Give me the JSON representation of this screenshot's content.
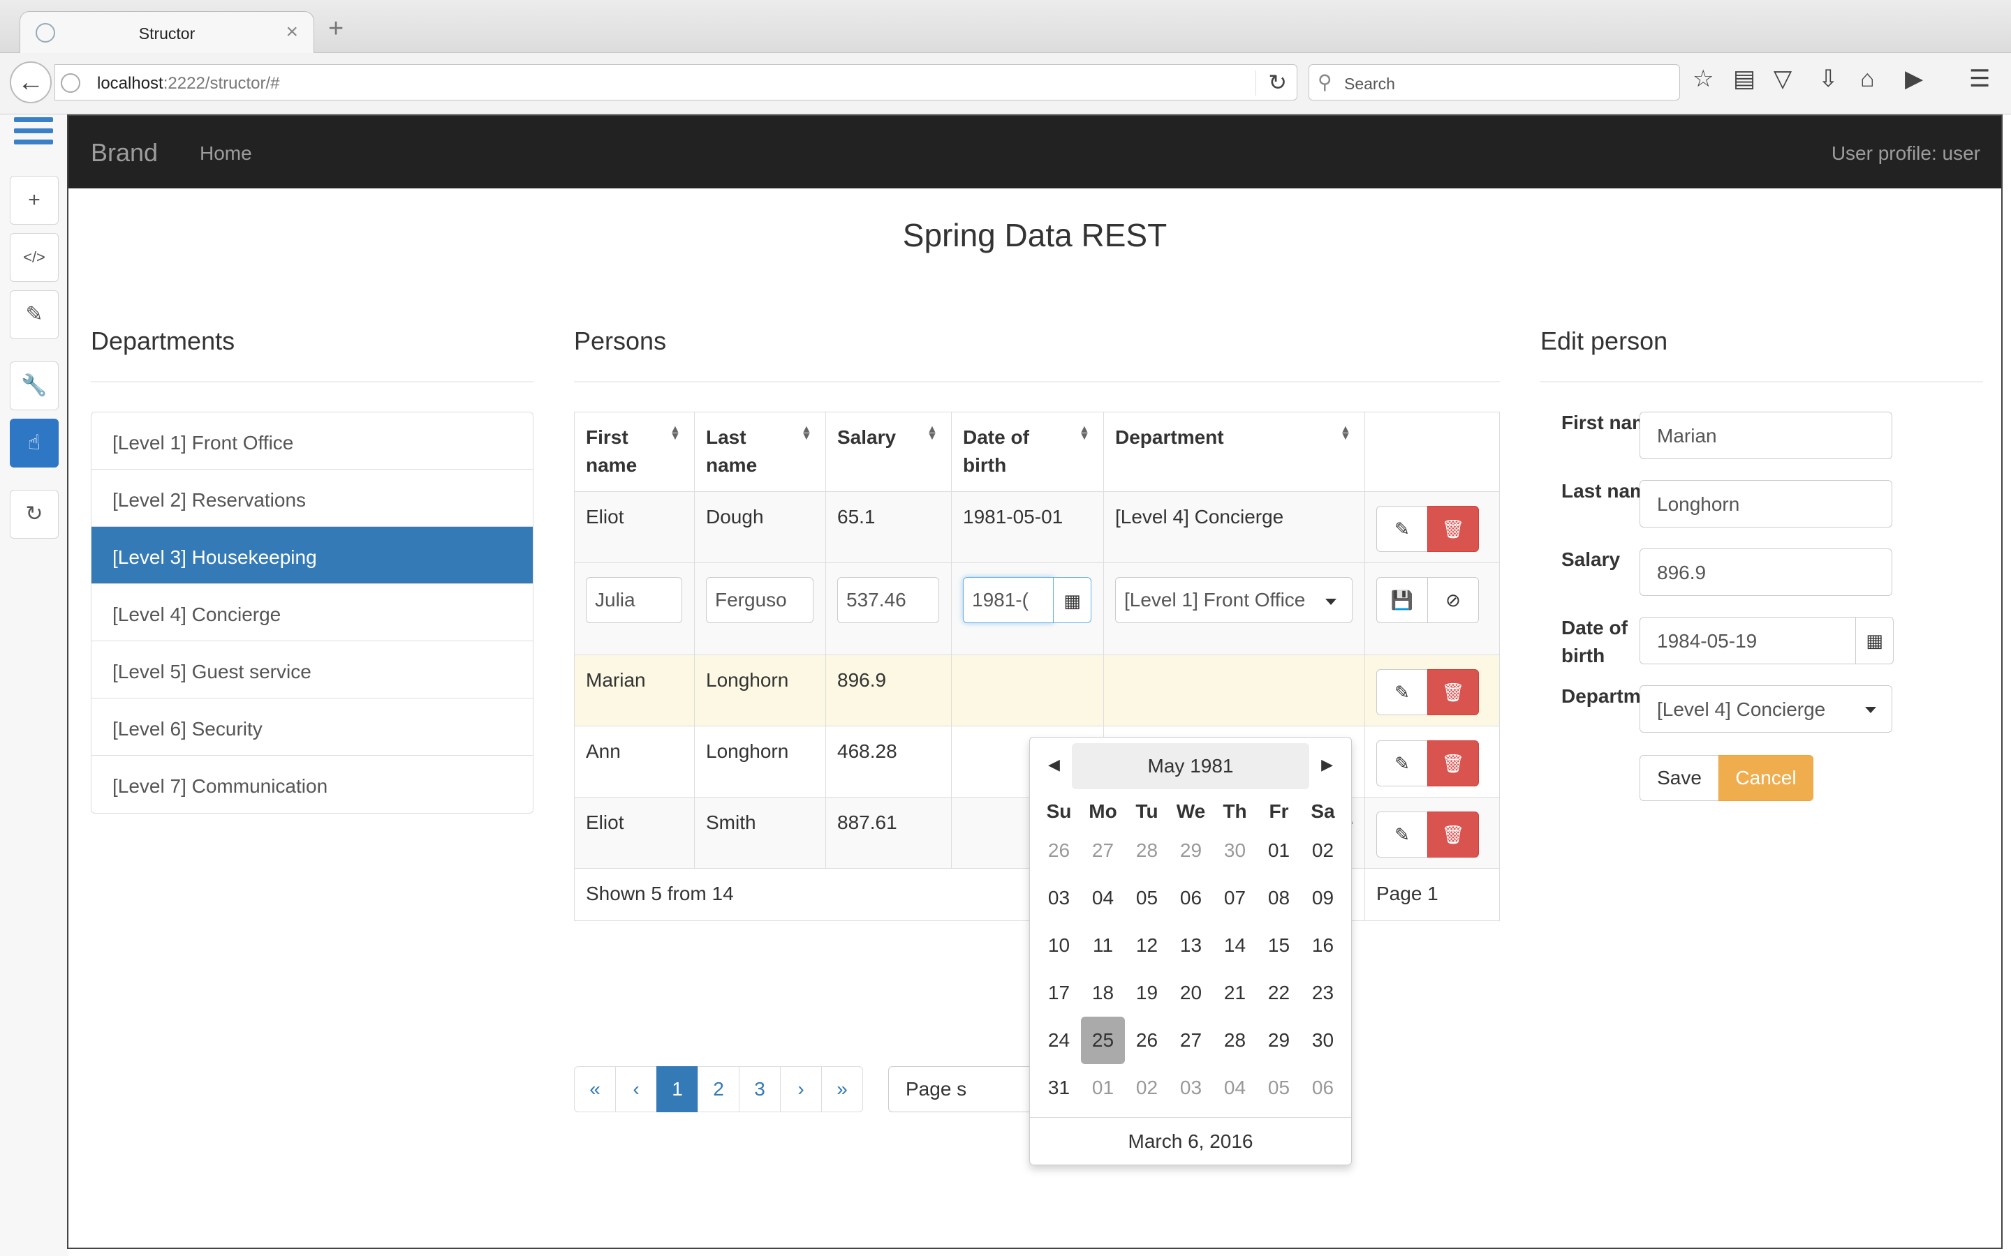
{
  "browser": {
    "tab_title": "Structor",
    "tab_close": "×",
    "new_tab": "+",
    "url_host": "localhost",
    "url_rest": ":2222/structor/#",
    "search_placeholder": "Search"
  },
  "app": {
    "brand": "Brand",
    "nav_home": "Home",
    "user_profile": "User profile: user",
    "page_title": "Spring Data REST"
  },
  "departments": {
    "heading": "Departments",
    "items": [
      {
        "label": "[Level 1] Front Office"
      },
      {
        "label": "[Level 2] Reservations"
      },
      {
        "label": "[Level 3] Housekeeping"
      },
      {
        "label": "[Level 4] Concierge"
      },
      {
        "label": "[Level 5] Guest service"
      },
      {
        "label": "[Level 6] Security"
      },
      {
        "label": "[Level 7] Communication"
      }
    ],
    "selected_index": 2
  },
  "persons": {
    "heading": "Persons",
    "columns": {
      "first_name": "First\nname",
      "last_name": "Last\nname",
      "salary": "Salary",
      "dob": "Date of\nbirth",
      "department": "Department"
    },
    "rows": [
      {
        "first": "Eliot",
        "last": "Dough",
        "salary": "65.1",
        "dob": "1981-05-01",
        "dept": "[Level 4] Concierge"
      },
      {
        "first": "Marian",
        "last": "Longhorn",
        "salary": "896.9",
        "dob": "",
        "dept": ""
      },
      {
        "first": "Ann",
        "last": "Longhorn",
        "salary": "468.28",
        "dob": "",
        "dept": ""
      },
      {
        "first": "Eliot",
        "last": "Smith",
        "salary": "887.61",
        "dob": "",
        "dept": "ice"
      }
    ],
    "editing_row": {
      "first": "Julia",
      "last": "Ferguso",
      "salary": "537.46",
      "dob": "1981-(",
      "dept": "[Level 1] Front Office"
    },
    "footer_shown": "Shown 5 from 14",
    "footer_page": "Page 1",
    "pagination": [
      "«",
      "‹",
      "1",
      "2",
      "3",
      "›",
      "»"
    ],
    "active_page": "1",
    "page_size_label": "Page s"
  },
  "datepicker": {
    "month_label": "May 1981",
    "weekdays": [
      "Su",
      "Mo",
      "Tu",
      "We",
      "Th",
      "Fr",
      "Sa"
    ],
    "weeks": [
      [
        "26",
        "27",
        "28",
        "29",
        "30",
        "01",
        "02"
      ],
      [
        "03",
        "04",
        "05",
        "06",
        "07",
        "08",
        "09"
      ],
      [
        "10",
        "11",
        "12",
        "13",
        "14",
        "15",
        "16"
      ],
      [
        "17",
        "18",
        "19",
        "20",
        "21",
        "22",
        "23"
      ],
      [
        "24",
        "25",
        "26",
        "27",
        "28",
        "29",
        "30"
      ],
      [
        "31",
        "01",
        "02",
        "03",
        "04",
        "05",
        "06"
      ]
    ],
    "selected_day": "25",
    "today_label": "March 6, 2016"
  },
  "edit_person": {
    "heading": "Edit person",
    "first_name_label": "First name",
    "first_name_value": "Marian",
    "last_name_label": "Last name",
    "last_name_value": "Longhorn",
    "salary_label": "Salary",
    "salary_value": "896.9",
    "dob_label": "Date of\nbirth",
    "dob_value": "1984-05-19",
    "department_label": "Department",
    "department_value": "[Level 4] Concierge",
    "save_label": "Save",
    "cancel_label": "Cancel"
  },
  "colors": {
    "primary": "#337ab7",
    "danger": "#d9534f",
    "warning": "#f0ad4e",
    "navbar": "#222222",
    "row_highlight": "#fcf8e3"
  }
}
